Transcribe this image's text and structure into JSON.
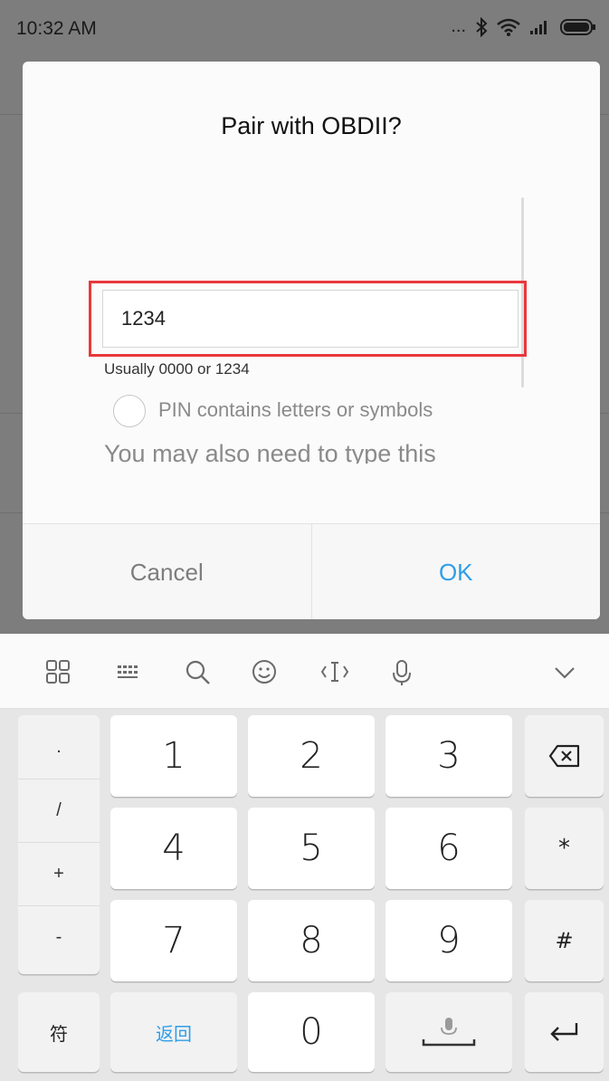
{
  "status_bar": {
    "time": "10:32 AM",
    "overflow": "...",
    "icons": [
      "bluetooth-icon",
      "wifi-icon",
      "signal-icon",
      "battery-icon"
    ]
  },
  "dialog": {
    "title": "Pair with OBDII?",
    "pin_value": "1234",
    "pin_hint": "Usually 0000 or 1234",
    "pin_option_label": "PIN contains letters or symbols",
    "also_type_text": "You may also need to type this",
    "cancel_label": "Cancel",
    "ok_label": "OK"
  },
  "keyboard": {
    "toolbar_icons": [
      "grid-icon",
      "keyboard-icon",
      "search-icon",
      "emoji-icon",
      "cursor-icon",
      "mic-icon",
      "collapse-icon"
    ],
    "symbols": [
      ".",
      "/",
      "+",
      "-"
    ],
    "digits": [
      "1",
      "2",
      "3",
      "4",
      "5",
      "6",
      "7",
      "8",
      "9",
      "0"
    ],
    "func_keys": {
      "star": "*",
      "hash": "#",
      "fu": "符",
      "back": "返回"
    }
  },
  "colors": {
    "accent": "#2f9ee9",
    "highlight": "#e8383d",
    "overlay": "#7d7d7d"
  }
}
